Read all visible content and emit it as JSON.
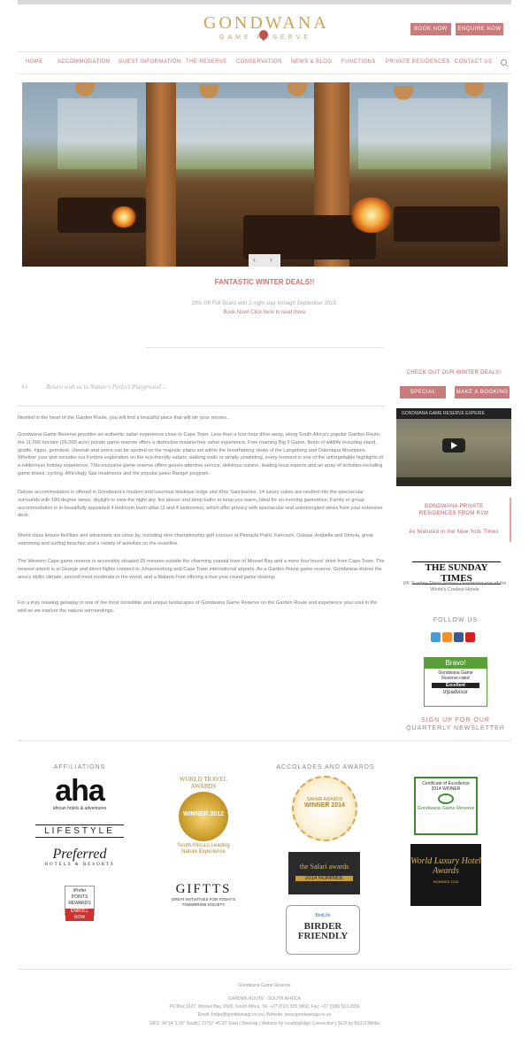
{
  "logo": {
    "name": "GONDWANA",
    "tag": "GAME   RESERVE"
  },
  "header_buttons": {
    "book": "BOOK NOW",
    "enquire": "ENQUIRE NOW"
  },
  "nav": [
    "HOME",
    "ACCOMMODATION",
    "GUEST INFORMATION",
    "THE RESERVE",
    "CONSERVATION",
    "NEWS & BLOG",
    "FUNCTIONS",
    "PRIVATE RESIDENCES",
    "CONTACT US"
  ],
  "deals": {
    "title": "FANTASTIC WINTER DEALS!!",
    "line1": "20% Off Full Board with 2 night stay through September 2015.",
    "line2": "Book Now! Click here to read more"
  },
  "tagline": "Return with us to Nature's Perfect Playground ...",
  "paragraphs": [
    "Nestled in the heart of the Garden Route, you will find a beautiful place that will stir your senses...",
    "Gondwana Game Reserve provides an authentic safari experience close to Cape Town. Less than a four-hour drive away, along South Africa's popular Garden Route, the 11,000 hectare (26,000 acre) private game reserve offers a distinctive malaria-free safari experience. Free roaming Big 5 Game, fleets of wildlife including eland, giraffe, hippo, gemsbok, cheetah and zebra can be spotted on the majestic plains set within the breathtaking views of the Langeberg and Outeniqua Mountains. Whether your visit includes our Fynbos exploration on the eco-friendly safaris, walking trails or simply unwinding, every moment is one of the unforgettable highlights of a wilderness holiday experience. This exclusive game reserve offers guests attentive service, delicious cuisine, leading local experts and an array of activities including game drives, cycling, Africology Spa treatments and the popular junior Ranger program.",
    "Deluxe accommodation is offered in Gondwana's modern and luxurious boutique lodge and Khoi Sanctuaries. 14 luxury suites are nestled into the spectacular surrounds with 180-degree views, skylight to view the night sky, fire places and deep baths to keep you warm. Ideal for an evening gamedrive. Family or group accommodation is in beautifully appointed 4 bedroom bush villas (3 and 4 bedrooms), which offer privacy with spectacular and uninterrupted views from your extensive deck.",
    "World-class leisure facilities and attractions are close by, including nine championship golf courses at Pinnacle Point, Fancourt, Oubaai, Arabella and Simola, great swimming and surfing beaches and a variety of activities on the coastline.",
    "The Western Cape game reserve is accessibly situated 25 minutes outside the charming coastal town of Mossel Bay and a mere four hours' drive from Cape Town. The nearest airport is at George and direct flights connect to Johannesburg and Cape Town international airports. As a Garden Route game reserve, Gondwana shares the area's idyllic climate, second most moderate in the world, and a Malaria Free offering a true year round game viewing.",
    "For a truly relaxing getaway in one of the most incredible and unique landscapes of Gondwana Game Reserve on the Garden Route and experience your soul in the wild as we explore the natural surroundings."
  ],
  "sidebar": {
    "winter_link": "CHECK OUT OUR WINTER DEALS!",
    "special_offers": "SPECIAL OFFERS",
    "make_booking": "MAKE A BOOKING",
    "video_title": "GONDWANA GAME RESERVE EXPERIE",
    "private_title": "GONDWANA PRIVATE RESIDENCES FROM R1M",
    "private_sub": "As featured in the New York Times",
    "sunday_logo": "THE SUNDAY TIMES",
    "sunday_text": "UK Sunday Times Names Gondwana one of the World's Coolest Hotels",
    "follow": "FOLLOW US",
    "newsletter": "SIGN UP FOR OUR QUARTERLY NEWSLETTER",
    "tripadvisor": {
      "head": "Bravo!",
      "l1": "Gondwana Game",
      "l2": "Reserve rated",
      "l3": "Excellent",
      "brand": "tripadvisor"
    }
  },
  "affiliations": {
    "title": "AFFILIATIONS",
    "aha": "aha",
    "aha_sub": "african hotels & adventures",
    "lifestyle": "LIFESTYLE",
    "preferred": "Preferred",
    "preferred_sub": "HOTELS & RESORTS",
    "iprefer": "iPrefer",
    "iprefer_sub": "POINTS REWARDS",
    "iprefer_r": "ENROLL NOW"
  },
  "awards": {
    "title": "ACCOLADES AND AWARDS",
    "wta_top": "WORLD TRAVEL AWARDS",
    "wta_medal": "WINNER 2012",
    "wta_bottom": "South Africa's Leading Nature Experience",
    "giffts": "GIFTTS",
    "giffts_sub": "GREAT INITIATIVES FOR TODAY'S TOMORROW SOCIETY",
    "safari_winner_1": "SAFARI AWARDS",
    "safari_winner_2": "WINNER 2014",
    "safari_nom_1": "the Safari awards",
    "safari_nom_2": "2014 NOMINEE",
    "birder_logo": "BirdLife",
    "birder": "BIRDER FRIENDLY",
    "coe_head": "Certificate of Excellence",
    "coe_year": "2014 WINNER",
    "coe_name": "Gondwana Game Reserve",
    "wlh": "World Luxury Hotel Awards",
    "wlh_sub": "NOMINEE 2015"
  },
  "footer": {
    "img_alt": "Gondwana Game Reserve",
    "region": "GARDEN ROUTE - SOUTH AFRICA",
    "address": "PO Box 1527, Mossel Bay, 6500, South Africa, Tel: +27 (0)21 555 0800, Fax: +27 (0)86 513 2556",
    "email": "Email: lodge@gondwanagr.co.za | Website: www.gondwanagr.co.za",
    "credits": "GPS: 34°14' 1.03\" South | 21°52' 46.20\" East | Sitemap | Website by LeadingEdge Connection | SEO by BOLD Media"
  },
  "colors": {
    "accent": "#c97c7c",
    "gold": "#c9a55c"
  }
}
